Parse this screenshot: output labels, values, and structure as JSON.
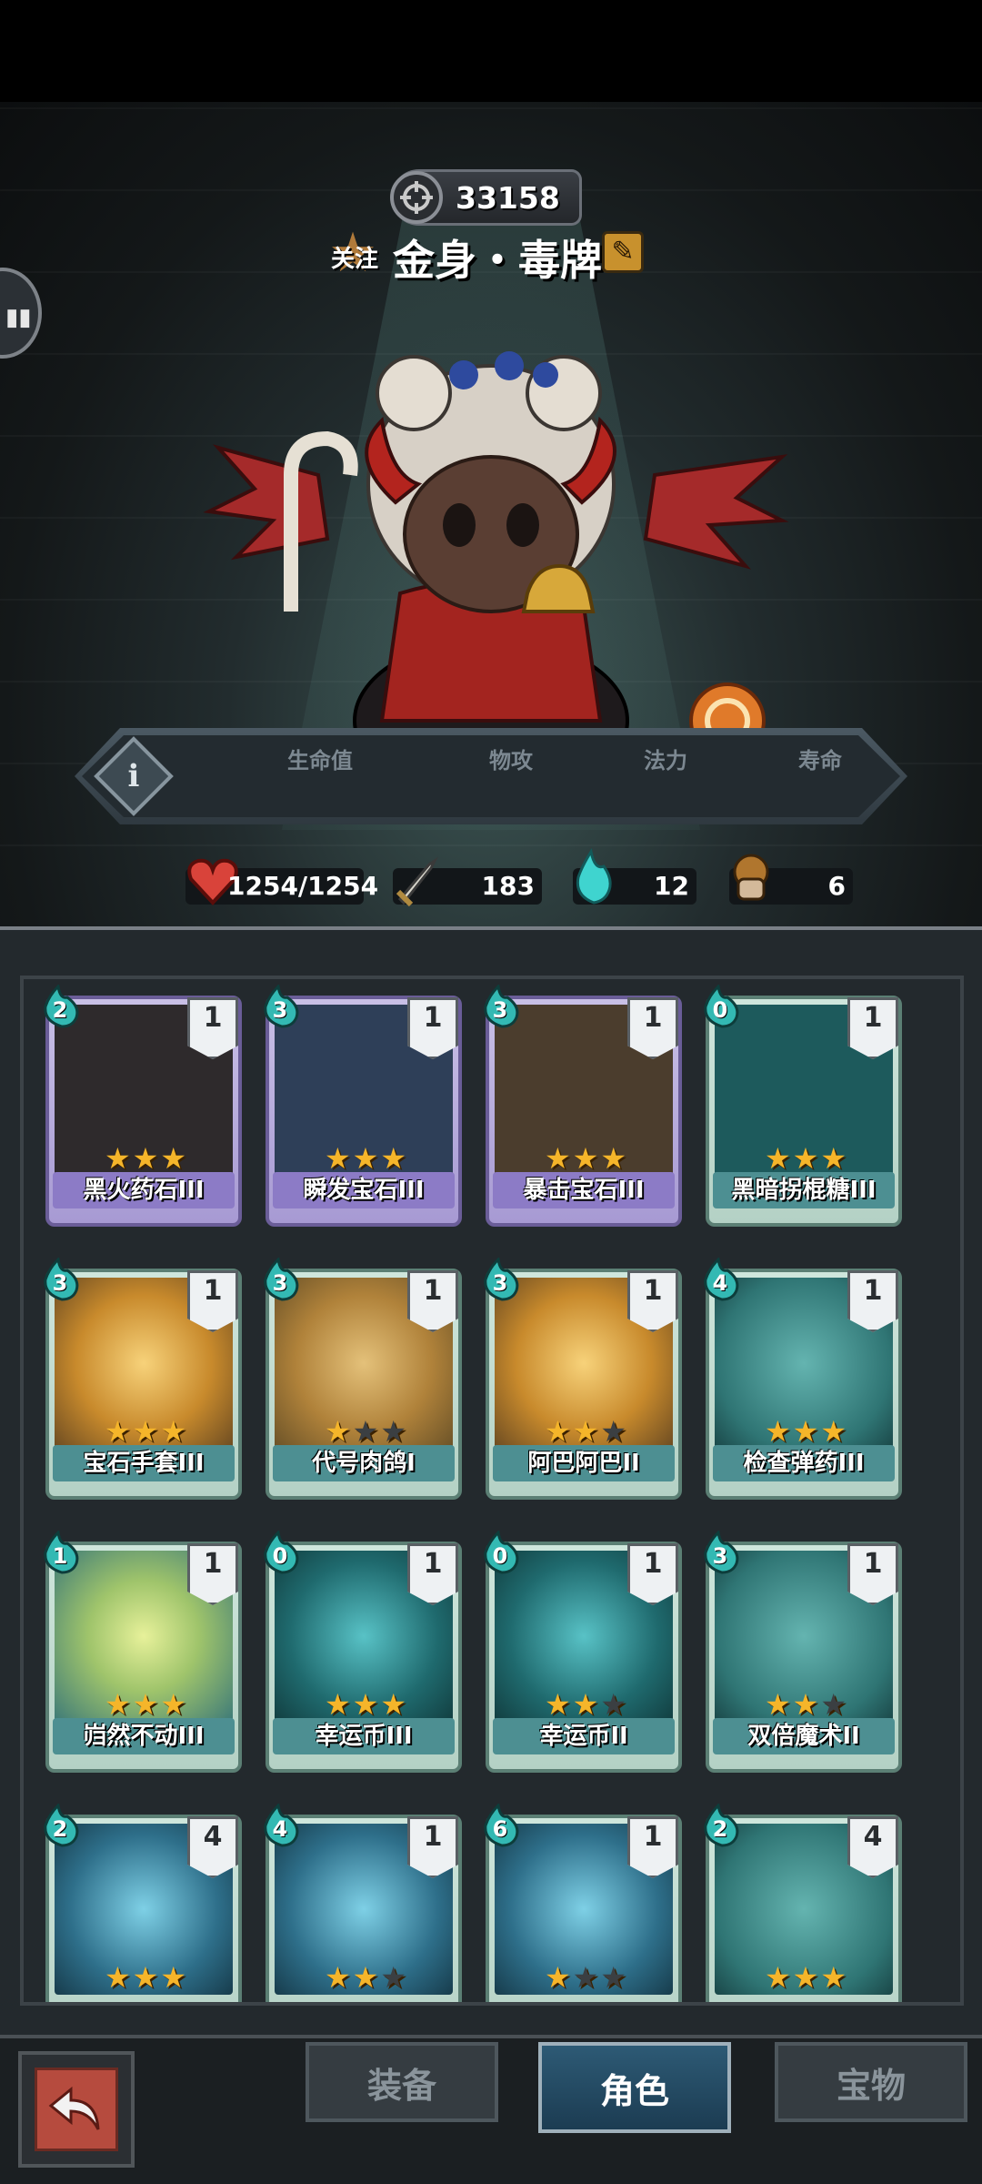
{
  "header": {
    "power_value": "33158",
    "follow_label": "关注",
    "character_name": "金身・毒牌",
    "icons": [
      "crosshair-icon",
      "edit-icon",
      "side-tab-eyes-icon"
    ]
  },
  "skills": [
    "slash-skill-icon",
    "bow-skill-icon",
    "clock-skill-icon",
    "pickaxe-skill-icon",
    "armor-skill-icon",
    "skull-skill-icon"
  ],
  "stats": {
    "hp_label": "生命值",
    "hp_value": "1254/1254",
    "atk_label": "物攻",
    "atk_value": "183",
    "mana_label": "法力",
    "mana_value": "12",
    "life_label": "寿命",
    "life_value": "6"
  },
  "cards": [
    {
      "name": "黑火药石III",
      "cost": "2",
      "level": "1",
      "stars": 3,
      "rarity": "purple",
      "art": "art-dark"
    },
    {
      "name": "瞬发宝石III",
      "cost": "3",
      "level": "1",
      "stars": 3,
      "rarity": "purple",
      "art": "art-blue"
    },
    {
      "name": "暴击宝石III",
      "cost": "3",
      "level": "1",
      "stars": 3,
      "rarity": "purple",
      "art": "art-brown"
    },
    {
      "name": "黑暗拐棍糖III",
      "cost": "0",
      "level": "1",
      "stars": 3,
      "rarity": "teal",
      "art": "art-cyan"
    },
    {
      "name": "宝石手套III",
      "cost": "3",
      "level": "1",
      "stars": 3,
      "rarity": "teal",
      "art": "art-sun"
    },
    {
      "name": "代号肉鸽I",
      "cost": "3",
      "level": "1",
      "stars": 1,
      "rarity": "teal",
      "art": "art-sun2"
    },
    {
      "name": "阿巴阿巴II",
      "cost": "3",
      "level": "1",
      "stars": 2,
      "rarity": "teal",
      "art": "art-sun"
    },
    {
      "name": "检查弹药III",
      "cost": "4",
      "level": "1",
      "stars": 3,
      "rarity": "teal",
      "art": "art-teal"
    },
    {
      "name": "岿然不动III",
      "cost": "1",
      "level": "1",
      "stars": 3,
      "rarity": "teal",
      "art": "art-lime"
    },
    {
      "name": "幸运币III",
      "cost": "0",
      "level": "1",
      "stars": 3,
      "rarity": "teal",
      "art": "art-swirl"
    },
    {
      "name": "幸运币II",
      "cost": "0",
      "level": "1",
      "stars": 2,
      "rarity": "teal",
      "art": "art-swirl"
    },
    {
      "name": "双倍魔术II",
      "cost": "3",
      "level": "1",
      "stars": 2,
      "rarity": "teal",
      "art": "art-teal"
    },
    {
      "name": "",
      "cost": "2",
      "level": "4",
      "stars": 3,
      "rarity": "teal",
      "art": "art-ice"
    },
    {
      "name": "",
      "cost": "4",
      "level": "1",
      "stars": 2,
      "rarity": "teal",
      "art": "art-ice"
    },
    {
      "name": "",
      "cost": "6",
      "level": "1",
      "stars": 1,
      "rarity": "teal",
      "art": "art-ice"
    },
    {
      "name": "",
      "cost": "2",
      "level": "4",
      "stars": 3,
      "rarity": "teal",
      "art": "art-teal"
    }
  ],
  "nav": {
    "back_icon": "back-arrow-icon",
    "tabs": [
      {
        "label": "装备",
        "active": false
      },
      {
        "label": "角色",
        "active": true
      },
      {
        "label": "宝物",
        "active": false
      }
    ]
  }
}
